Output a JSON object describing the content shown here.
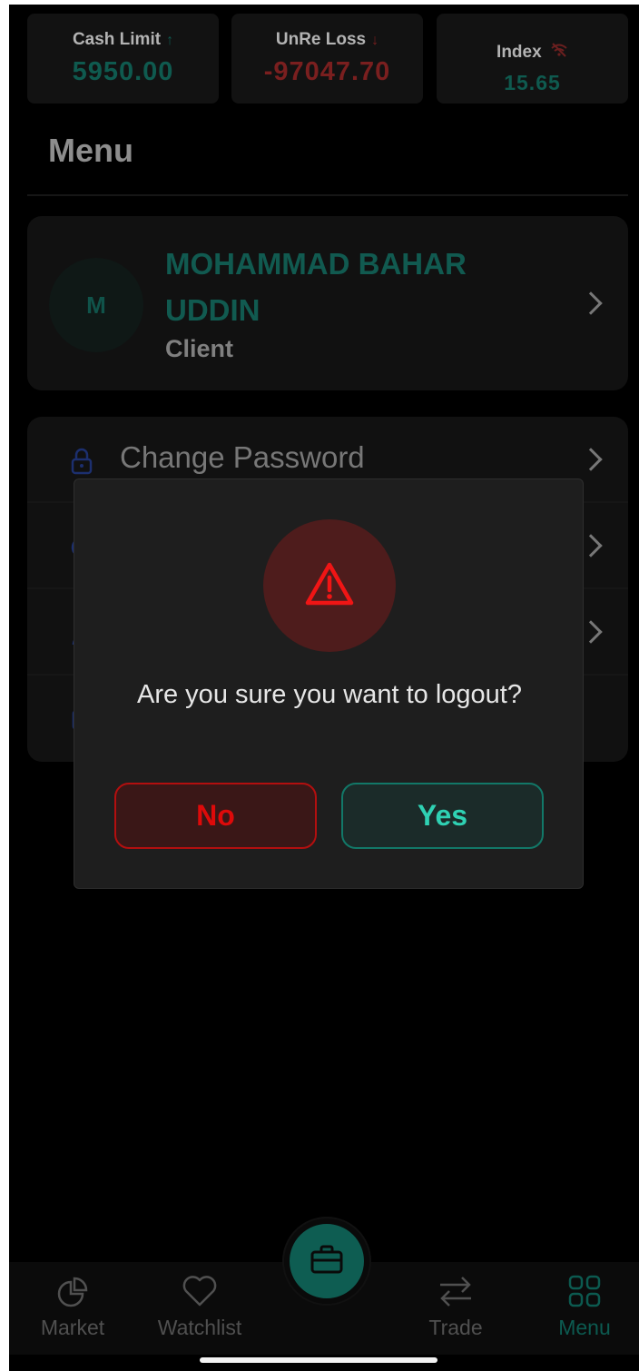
{
  "stats": {
    "cash_limit": {
      "label": "Cash Limit",
      "arrow": "↑",
      "value": "5950.00",
      "color": "#0f5a4f"
    },
    "unre_loss": {
      "label": "UnRe Loss",
      "arrow": "↓",
      "value": "-97047.70",
      "color": "#7a1f1f"
    },
    "index": {
      "label": "Index",
      "value": "15.65",
      "icon": "wifi-off-icon",
      "color": "#0f5a4f"
    }
  },
  "page": {
    "title": "Menu"
  },
  "profile": {
    "initial": "M",
    "name": "MOHAMMAD BAHAR UDDIN",
    "role": "Client"
  },
  "menu": {
    "items": [
      {
        "label": "Change Password",
        "icon": "lock-icon"
      }
    ]
  },
  "dialog": {
    "icon": "warning-icon",
    "message": "Are you sure you want to logout?",
    "no_label": "No",
    "yes_label": "Yes"
  },
  "nav": {
    "market": "Market",
    "watchlist": "Watchlist",
    "portfolio_icon": "briefcase-icon",
    "trade": "Trade",
    "menu": "Menu",
    "active": "Menu"
  },
  "colors": {
    "accent": "#0e5d52",
    "danger": "#de0a0a",
    "yes_text": "#2fd1b3"
  }
}
